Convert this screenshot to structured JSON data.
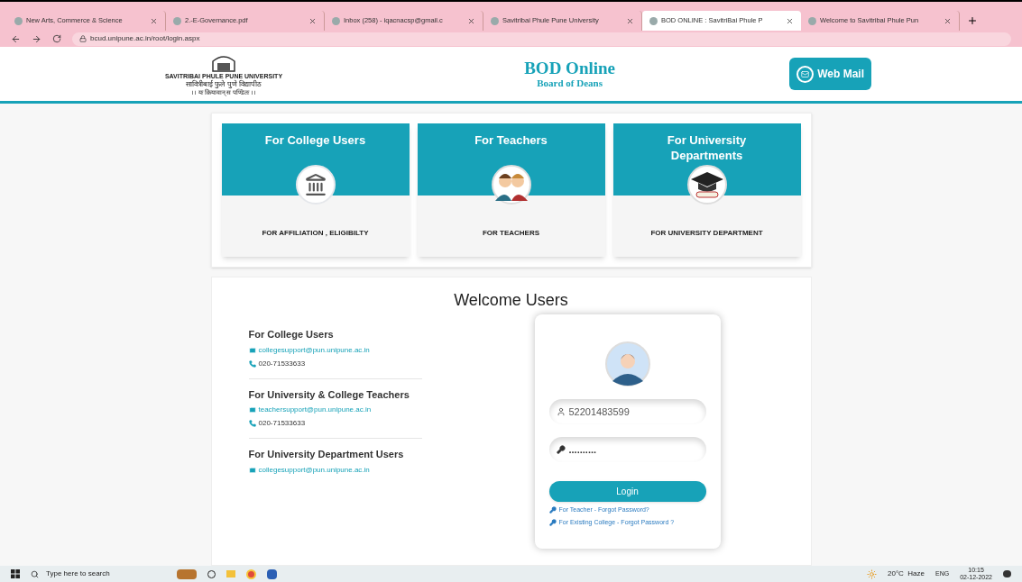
{
  "browser": {
    "tabs": [
      {
        "title": "New Arts, Commerce & Science",
        "selected": false
      },
      {
        "title": "2.-E-Governance.pdf",
        "selected": false
      },
      {
        "title": "Inbox (258) - iqacnacsp@gmail.c",
        "selected": false
      },
      {
        "title": "Savitribai Phule Pune University",
        "selected": false
      },
      {
        "title": "BOD ONLINE : SavitriBai Phule P",
        "selected": true
      },
      {
        "title": "Welcome to Savitribai Phule Pun",
        "selected": false
      }
    ],
    "url": "bcud.unipune.ac.in/root/login.aspx"
  },
  "header": {
    "university": "SAVITRIBAI PHULE PUNE UNIVERSITY",
    "university_marathi": "सावित्रीबाई फुले पुणे विद्यापीठ",
    "motto": "।। यः क्रियावान् स पण्डितः ।।",
    "title": "BOD Online",
    "subtitle": "Board of Deans",
    "webmail": "Web Mail"
  },
  "portals": [
    {
      "kind": "college",
      "title": "For College Users",
      "caption": "FOR AFFILIATION , ELIGIBILTY"
    },
    {
      "kind": "teachers",
      "title": "For Teachers",
      "caption": "FOR TEACHERS"
    },
    {
      "kind": "department",
      "title": "For University Departments",
      "caption": "FOR UNIVERSITY DEPARTMENT"
    }
  ],
  "welcome": {
    "title": "Welcome Users",
    "contacts": [
      {
        "heading": "For College Users",
        "email": "collegesupport@pun.unipune.ac.in",
        "phone": "020-71533633"
      },
      {
        "heading": "For University & College Teachers",
        "email": "teachersupport@pun.unipune.ac.in",
        "phone": "020-71533633"
      },
      {
        "heading": "For University Department Users",
        "email": "collegesupport@pun.unipune.ac.in"
      }
    ]
  },
  "login": {
    "username": "52201483599",
    "password": "..........",
    "button": "Login",
    "links": [
      "For Teacher - Forgot Password?",
      "For Existing College - Forgot Password ?"
    ]
  },
  "taskbar": {
    "search_placeholder": "Type here to search",
    "weather": "20°C  Haze",
    "language": "ENG",
    "time": "10:15",
    "date": "02-12-2022"
  }
}
